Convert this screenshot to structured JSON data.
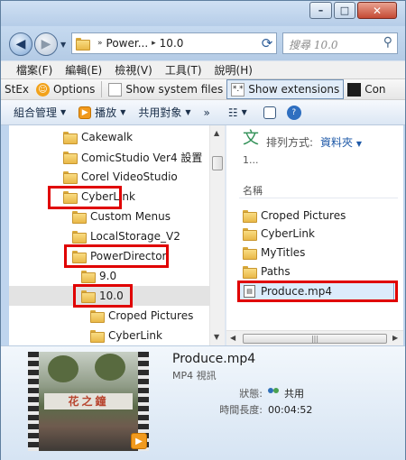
{
  "window": {
    "controls": {
      "minimize": "–",
      "maximize": "□",
      "close": "✕"
    }
  },
  "address_bar": {
    "segments": [
      "Power...",
      "10.0"
    ],
    "search_placeholder": "搜尋 10.0"
  },
  "menu_bar": {
    "items": [
      "檔案(F)",
      "編輯(E)",
      "檢視(V)",
      "工具(T)",
      "說明(H)"
    ]
  },
  "stex_toolbar": {
    "items": [
      "StEx",
      "Options",
      "Show system files",
      "Show extensions",
      "Con"
    ]
  },
  "command_bar": {
    "items": [
      "組合管理",
      "播放",
      "共用對象",
      "»"
    ]
  },
  "folder_tree": {
    "items": [
      "Cakewalk",
      "ComicStudio Ver4 設置",
      "Corel VideoStudio",
      "CyberLink",
      "Custom Menus",
      "LocalStorage_V2",
      "PowerDirector",
      "9.0",
      "10.0",
      "Croped Pictures",
      "CyberLink"
    ],
    "selected": "10.0",
    "highlighted": [
      "CyberLink",
      "PowerDirector",
      "10.0"
    ]
  },
  "file_list": {
    "sort_label": "排列方式:",
    "sort_value": "資料夾",
    "count": "1...",
    "column_header": "名稱",
    "items": [
      "Croped Pictures",
      "CyberLink",
      "MyTitles",
      "Paths",
      "Produce.mp4"
    ],
    "selected": "Produce.mp4"
  },
  "details_pane": {
    "file_name": "Produce.mp4",
    "file_type": "MP4 視訊",
    "status_label": "狀態:",
    "status_value": "共用",
    "duration_label": "時間長度:",
    "duration_value": "00:04:52",
    "thumbnail_sign": "花之鐘"
  },
  "colors": {
    "highlight_box": "#e00000",
    "selection": "#dcecfc",
    "accent_link": "#1f5aa8"
  }
}
